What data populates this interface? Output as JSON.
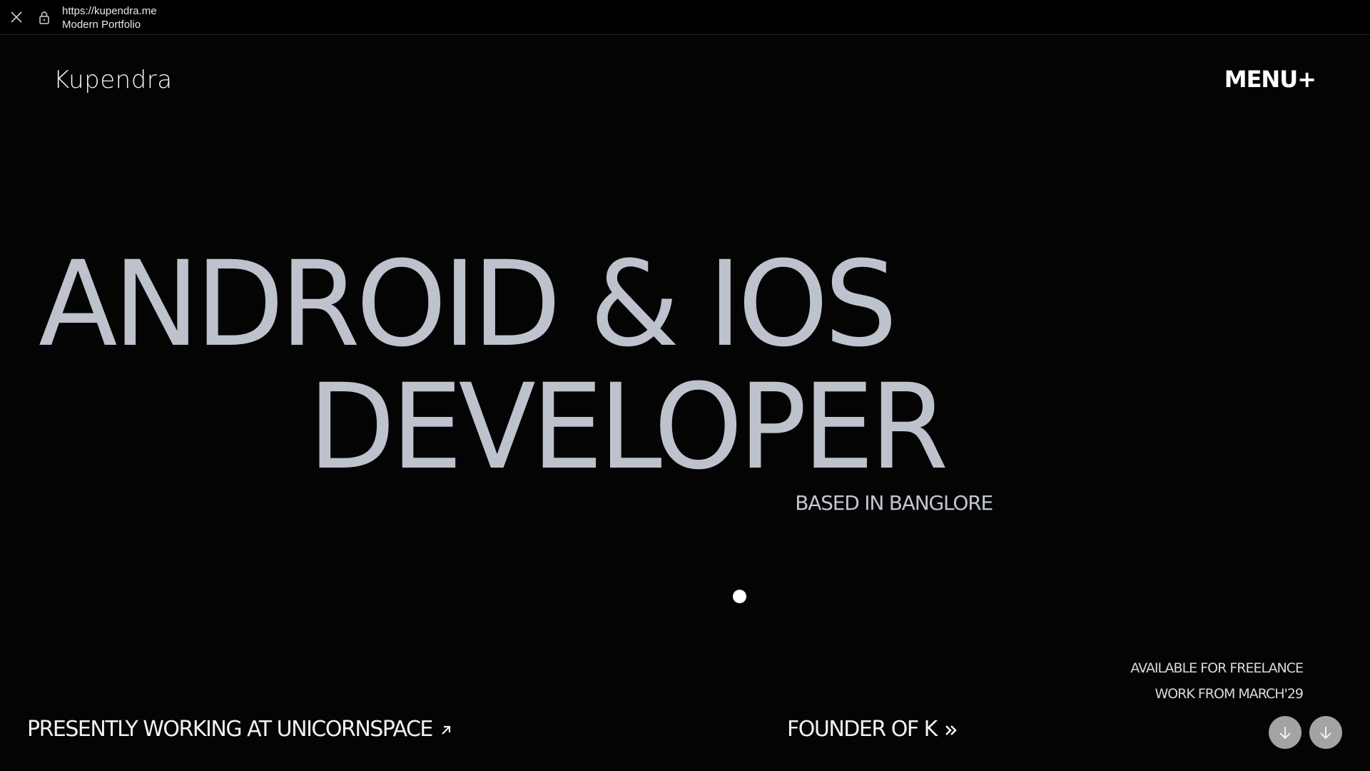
{
  "browser": {
    "url": "https://kupendra.me",
    "title": "Modern Portfolio"
  },
  "header": {
    "logo": "Kupendra",
    "menu_label": "MENU+"
  },
  "hero": {
    "line1": "ANDROID & IOS",
    "line2": "DEVELOPER",
    "location": "BASED IN BANGLORE"
  },
  "availability": {
    "line1": "AVAILABLE FOR FREELANCE",
    "line2": "WORK FROM MARCH'29"
  },
  "footer": {
    "working_text": "PRESENTLY WORKING AT UNICORNSPACE",
    "founder_text": "FOUNDER OF K"
  },
  "icons": {
    "close": "close-icon",
    "lock": "lock-icon",
    "arrow_up_right": "arrow-up-right-icon",
    "double_chevron": "double-chevron-right-icon",
    "arrow_down": "arrow-down-icon"
  },
  "colors": {
    "background": "#040404",
    "hero_text": "#bdc2cc",
    "button_bg": "#a3a3a3"
  }
}
